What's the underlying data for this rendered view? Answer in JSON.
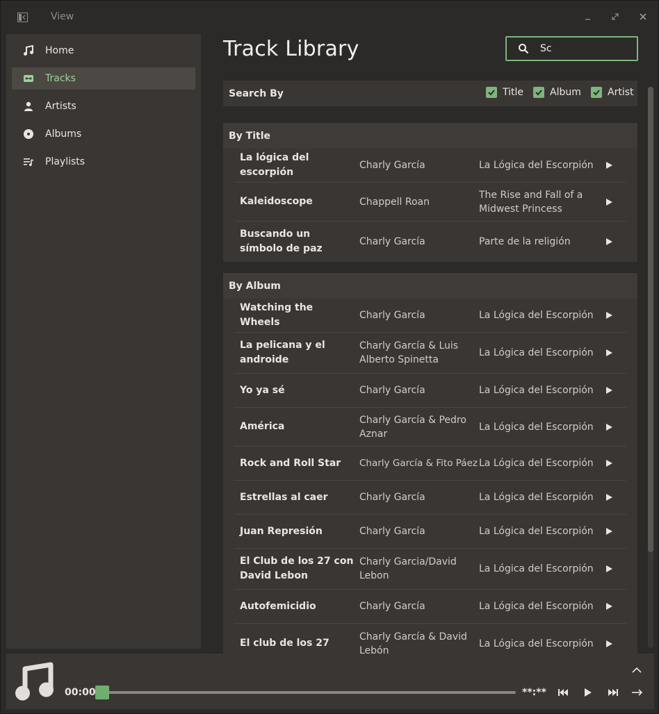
{
  "titlebar": {
    "menu_label": "View",
    "icons": [
      "sidebar-toggle-icon",
      "minimize-icon",
      "maximize-icon",
      "close-icon"
    ]
  },
  "sidebar": {
    "items": [
      {
        "label": "Home",
        "icon": "music-note-icon"
      },
      {
        "label": "Tracks",
        "icon": "cassette-icon",
        "active": true
      },
      {
        "label": "Artists",
        "icon": "person-icon"
      },
      {
        "label": "Albums",
        "icon": "disc-icon"
      },
      {
        "label": "Playlists",
        "icon": "playlist-icon"
      }
    ]
  },
  "main": {
    "title": "Track Library",
    "search": {
      "value": "Sc",
      "icon": "search-icon"
    },
    "search_by": {
      "label": "Search By",
      "options": [
        {
          "label": "Title",
          "checked": true
        },
        {
          "label": "Album",
          "checked": true
        },
        {
          "label": "Artist",
          "checked": true
        }
      ]
    },
    "sections": [
      {
        "heading": "By Title",
        "rows": [
          {
            "title": "La lógica del escorpión",
            "artist": "Charly García",
            "album": "La Lógica del Escorpión"
          },
          {
            "title": "Kaleidoscope",
            "artist": "Chappell Roan",
            "album": "The Rise and Fall of a Midwest Princess"
          },
          {
            "title": "Buscando un símbolo de paz",
            "artist": "Charly García",
            "album": "Parte de la religión"
          }
        ]
      },
      {
        "heading": "By Album",
        "rows": [
          {
            "title": "Watching the Wheels",
            "artist": "Charly García",
            "album": "La Lógica del Escorpión"
          },
          {
            "title": "La pelicana y el androide",
            "artist": "Charly García & Luis Alberto Spinetta",
            "album": "La Lógica del Escorpión"
          },
          {
            "title": "Yo ya sé",
            "artist": "Charly García",
            "album": "La Lógica del Escorpión"
          },
          {
            "title": "América",
            "artist": "Charly García & Pedro Aznar",
            "album": "La Lógica del Escorpión"
          },
          {
            "title": "Rock and Roll Star",
            "artist": "Charly García & Fito Páez",
            "album": "La Lógica del Escorpión"
          },
          {
            "title": "Estrellas al caer",
            "artist": "Charly García",
            "album": "La Lógica del Escorpión"
          },
          {
            "title": "Juan Represión",
            "artist": "Charly García",
            "album": "La Lógica del Escorpión"
          },
          {
            "title": "El Club de los 27 con David Lebon",
            "artist": "Charly Garcia/David Lebon",
            "album": "La Lógica del Escorpión"
          },
          {
            "title": "Autofemicidio",
            "artist": "Charly García",
            "album": "La Lógica del Escorpión"
          },
          {
            "title": "El club de los 27",
            "artist": "Charly García & David Lebón",
            "album": "La Lógica del Escorpión"
          }
        ]
      }
    ]
  },
  "player": {
    "current_time": "00:00",
    "total_time": "**:**",
    "progress": 0,
    "accent_color": "#6fae6f"
  }
}
